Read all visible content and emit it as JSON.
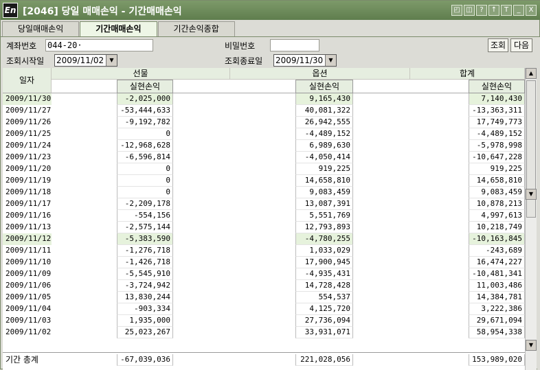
{
  "window": {
    "logo": "En",
    "title": "[2046] 당일 매매손익 - 기간매매손익",
    "controls": [
      "◰",
      "◫",
      "?",
      "↑",
      "T",
      "_",
      "X"
    ]
  },
  "tabs": [
    {
      "label": "당일매매손익",
      "active": false
    },
    {
      "label": "기간매매손익",
      "active": true
    },
    {
      "label": "기간손익종합",
      "active": false
    }
  ],
  "form": {
    "account_label": "계좌번호",
    "account_value": "044-20·",
    "password_label": "비밀번호",
    "start_label": "조회시작일",
    "start_value": "2009/11/02",
    "end_label": "조회종료일",
    "end_value": "2009/11/30",
    "query_button": "조회",
    "next_button": "다음"
  },
  "table": {
    "date_header": "일자",
    "group_headers": [
      "선물",
      "옵션",
      "합계"
    ],
    "sub_header": "실현손익",
    "rows": [
      {
        "date": "2009/11/30",
        "futures": "-2,025,000",
        "options": "9,165,430",
        "total": "7,140,430",
        "hl": true
      },
      {
        "date": "2009/11/27",
        "futures": "-53,444,633",
        "options": "40,081,322",
        "total": "-13,363,311"
      },
      {
        "date": "2009/11/26",
        "futures": "-9,192,782",
        "options": "26,942,555",
        "total": "17,749,773"
      },
      {
        "date": "2009/11/25",
        "futures": "0",
        "options": "-4,489,152",
        "total": "-4,489,152"
      },
      {
        "date": "2009/11/24",
        "futures": "-12,968,628",
        "options": "6,989,630",
        "total": "-5,978,998"
      },
      {
        "date": "2009/11/23",
        "futures": "-6,596,814",
        "options": "-4,050,414",
        "total": "-10,647,228"
      },
      {
        "date": "2009/11/20",
        "futures": "0",
        "options": "919,225",
        "total": "919,225"
      },
      {
        "date": "2009/11/19",
        "futures": "0",
        "options": "14,658,810",
        "total": "14,658,810"
      },
      {
        "date": "2009/11/18",
        "futures": "0",
        "options": "9,083,459",
        "total": "9,083,459"
      },
      {
        "date": "2009/11/17",
        "futures": "-2,209,178",
        "options": "13,087,391",
        "total": "10,878,213"
      },
      {
        "date": "2009/11/16",
        "futures": "-554,156",
        "options": "5,551,769",
        "total": "4,997,613"
      },
      {
        "date": "2009/11/13",
        "futures": "-2,575,144",
        "options": "12,793,893",
        "total": "10,218,749"
      },
      {
        "date": "2009/11/12",
        "futures": "-5,383,590",
        "options": "-4,780,255",
        "total": "-10,163,845",
        "hl": true
      },
      {
        "date": "2009/11/11",
        "futures": "-1,276,718",
        "options": "1,033,029",
        "total": "-243,689"
      },
      {
        "date": "2009/11/10",
        "futures": "-1,426,718",
        "options": "17,900,945",
        "total": "16,474,227"
      },
      {
        "date": "2009/11/09",
        "futures": "-5,545,910",
        "options": "-4,935,431",
        "total": "-10,481,341"
      },
      {
        "date": "2009/11/06",
        "futures": "-3,724,942",
        "options": "14,728,428",
        "total": "11,003,486"
      },
      {
        "date": "2009/11/05",
        "futures": "13,830,244",
        "options": "554,537",
        "total": "14,384,781"
      },
      {
        "date": "2009/11/04",
        "futures": "-903,334",
        "options": "4,125,720",
        "total": "3,222,386"
      },
      {
        "date": "2009/11/03",
        "futures": "1,935,000",
        "options": "27,736,094",
        "total": "29,671,094"
      },
      {
        "date": "2009/11/02",
        "futures": "25,023,267",
        "options": "33,931,071",
        "total": "58,954,338"
      }
    ],
    "total_row": {
      "label": "기간 총계",
      "futures": "-67,039,036",
      "options": "221,028,056",
      "total": "153,989,020"
    }
  },
  "scroll": {
    "up": "▲",
    "down": "▼"
  }
}
